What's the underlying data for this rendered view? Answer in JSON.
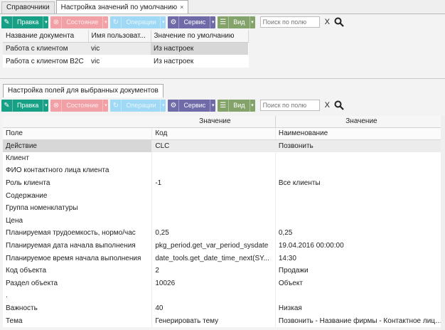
{
  "tabs": [
    {
      "label": "Справочники",
      "active": false
    },
    {
      "label": "Настройка значений по умолчанию",
      "active": true,
      "close": "×"
    }
  ],
  "toolbar": {
    "edit": "Правка",
    "state": "Состояние",
    "operation": "Операции",
    "service": "Сервис",
    "view": "Вид",
    "search_placeholder": "Поиск по полю",
    "clear": "X"
  },
  "grid1": {
    "columns": [
      "Название документа",
      "Имя пользоват...",
      "Значение по умолчанию"
    ],
    "rows": [
      [
        "Работа с клиентом",
        "vic",
        "Из настроек"
      ],
      [
        "Работа с клиентом B2C",
        "vic",
        "Из настроек"
      ]
    ]
  },
  "section2": {
    "tab_label": "Настройка полей для выбранных документов",
    "group_headers": [
      "Значение",
      "Значение"
    ],
    "columns": [
      "Поле",
      "Код",
      "Наименование"
    ],
    "rows": [
      [
        "Действие",
        "CLC",
        "Позвонить"
      ],
      [
        "Клиент",
        "",
        ""
      ],
      [
        "ФИО контактного лица клиента",
        "",
        ""
      ],
      [
        "Роль клиента",
        "-1",
        "Все клиенты"
      ],
      [
        "Содержание",
        "",
        ""
      ],
      [
        "Группа номенклатуры",
        "",
        ""
      ],
      [
        "Цена",
        "",
        ""
      ],
      [
        "Планируемая трудоемкость, нормо/час",
        "0,25",
        "0,25"
      ],
      [
        "Планируемая дата начала выполнения",
        "pkg_period.get_var_period_sysdate",
        "19.04.2016 00:00:00"
      ],
      [
        "Планируемое время начала выполнения",
        "date_tools.get_date_time_next(SY...",
        "14:30"
      ],
      [
        "Код объекта",
        "2",
        "Продажи"
      ],
      [
        "Раздел объекта",
        "10026",
        "Объект"
      ],
      [
        ".",
        "",
        ""
      ],
      [
        "Важность",
        "40",
        "Низкая"
      ],
      [
        "Тема",
        "Генерировать тему",
        "Позвонить - Название фирмы - Контактное лицо - ..."
      ]
    ]
  }
}
